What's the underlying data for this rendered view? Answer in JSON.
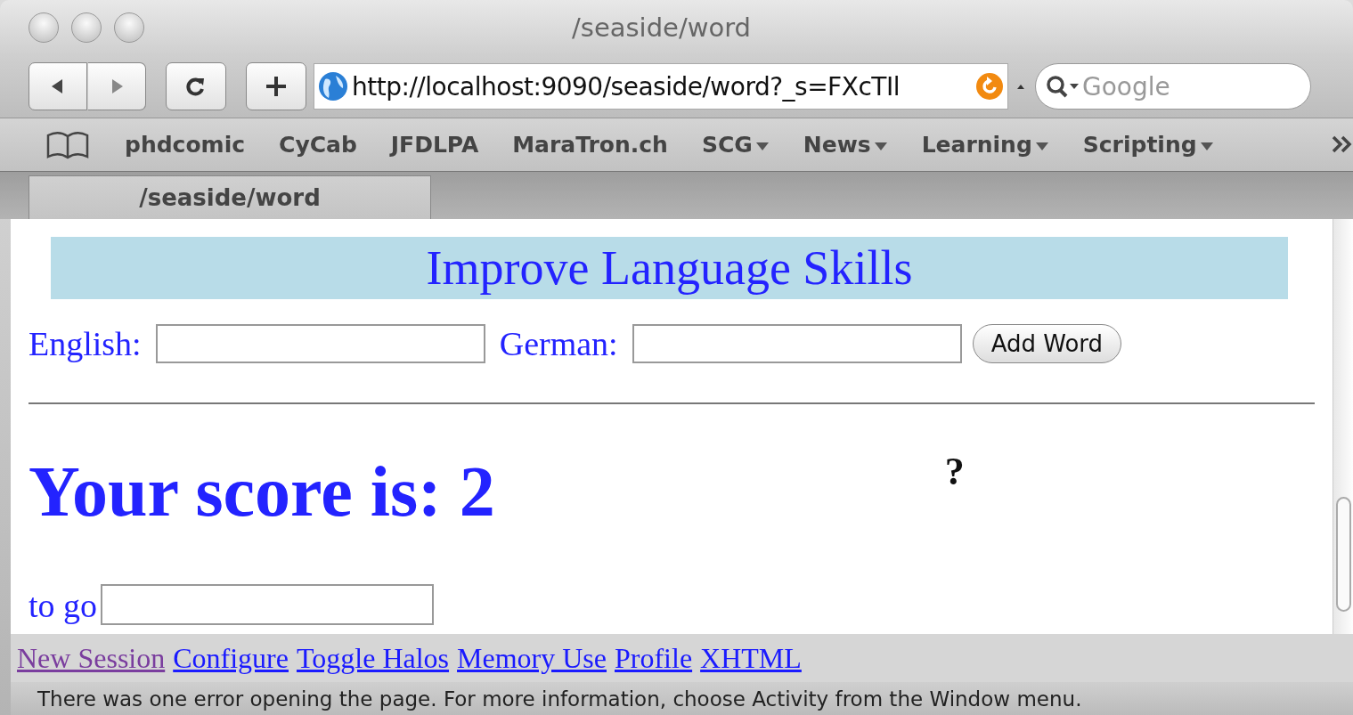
{
  "window": {
    "title": "/seaside/word"
  },
  "toolbar": {
    "url": "http://localhost:9090/seaside/word?_s=FXcTIl",
    "search_placeholder": "Google"
  },
  "bookmarks": [
    {
      "label": "phdcomic",
      "menu": false
    },
    {
      "label": "CyCab",
      "menu": false
    },
    {
      "label": "JFDLPA",
      "menu": false
    },
    {
      "label": "MaraTron.ch",
      "menu": false
    },
    {
      "label": "SCG",
      "menu": true
    },
    {
      "label": "News",
      "menu": true
    },
    {
      "label": "Learning",
      "menu": true
    },
    {
      "label": "Scripting",
      "menu": true
    }
  ],
  "tabs": [
    {
      "label": "/seaside/word",
      "selected": true
    }
  ],
  "page": {
    "banner": "Improve Language Skills",
    "fields": [
      {
        "label": "English:"
      },
      {
        "label": "German:"
      }
    ],
    "button": "Add Word",
    "score": "Your score is: 2",
    "question": "?",
    "answer_label": "to go"
  },
  "footer_links": [
    {
      "label": "New Session",
      "visited": true
    },
    {
      "label": "Configure",
      "visited": false
    },
    {
      "label": "Toggle Halos",
      "visited": false
    },
    {
      "label": "Memory Use",
      "visited": false
    },
    {
      "label": "Profile",
      "visited": false
    },
    {
      "label": "XHTML",
      "visited": false
    }
  ],
  "status_bar": "There was one error opening the page. For more information, choose Activity from the Window menu."
}
